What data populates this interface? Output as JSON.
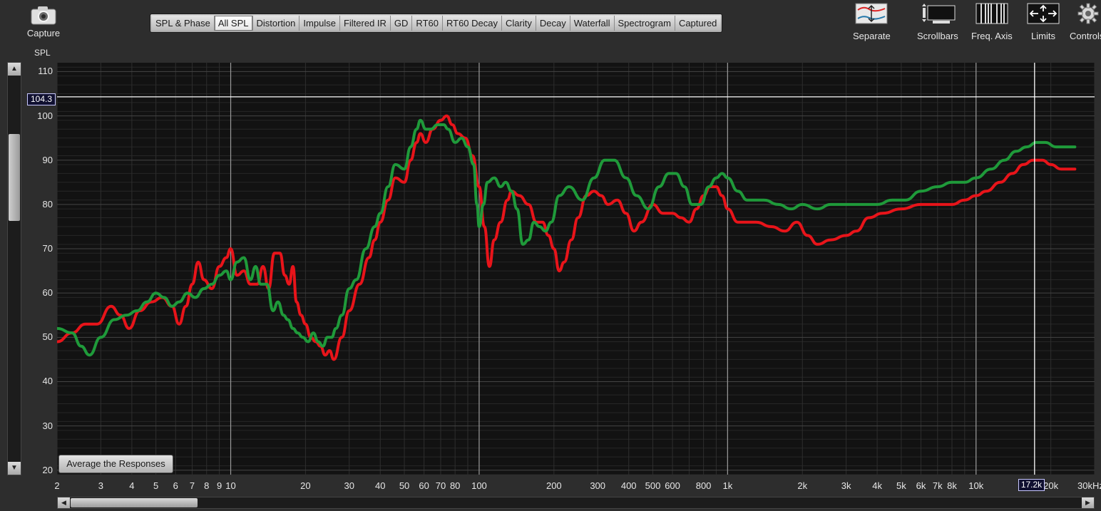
{
  "capture": {
    "label": "Capture"
  },
  "y_axis_title": "SPL",
  "tabs": [
    {
      "label": "SPL & Phase",
      "active": false
    },
    {
      "label": "All SPL",
      "active": true
    },
    {
      "label": "Distortion",
      "active": false
    },
    {
      "label": "Impulse",
      "active": false
    },
    {
      "label": "Filtered IR",
      "active": false
    },
    {
      "label": "GD",
      "active": false
    },
    {
      "label": "RT60",
      "active": false
    },
    {
      "label": "RT60 Decay",
      "active": false
    },
    {
      "label": "Clarity",
      "active": false
    },
    {
      "label": "Decay",
      "active": false
    },
    {
      "label": "Waterfall",
      "active": false
    },
    {
      "label": "Spectrogram",
      "active": false
    },
    {
      "label": "Captured",
      "active": false
    }
  ],
  "toolbar": {
    "separate": "Separate",
    "scrollbars": "Scrollbars",
    "freq_axis": "Freq. Axis",
    "limits": "Limits",
    "controls": "Controls"
  },
  "cursor": {
    "y_readout": "104.3",
    "x_readout": "17.2k"
  },
  "average_button": "Average the Responses",
  "colors": {
    "red_trace": "#e8141a",
    "green_trace": "#1f9a3a",
    "background": "#121212",
    "grid": "#3a3a3a",
    "cursor": "#ffffff"
  },
  "chart_data": {
    "type": "line",
    "x_scale": "log",
    "xlim": [
      2,
      30000
    ],
    "ylim": [
      19,
      112
    ],
    "y_ticks": [
      "110",
      "100",
      "90",
      "80",
      "70",
      "60",
      "50",
      "40",
      "30",
      "20"
    ],
    "x_ticks": [
      {
        "v": 2,
        "t": "2"
      },
      {
        "v": 3,
        "t": "3"
      },
      {
        "v": 4,
        "t": "4"
      },
      {
        "v": 5,
        "t": "5"
      },
      {
        "v": 6,
        "t": "6"
      },
      {
        "v": 7,
        "t": "7"
      },
      {
        "v": 8,
        "t": "8"
      },
      {
        "v": 9,
        "t": "9"
      },
      {
        "v": 10,
        "t": "10"
      },
      {
        "v": 20,
        "t": "20"
      },
      {
        "v": 30,
        "t": "30"
      },
      {
        "v": 40,
        "t": "40"
      },
      {
        "v": 50,
        "t": "50"
      },
      {
        "v": 60,
        "t": "60"
      },
      {
        "v": 70,
        "t": "70"
      },
      {
        "v": 80,
        "t": "80"
      },
      {
        "v": 100,
        "t": "100"
      },
      {
        "v": 200,
        "t": "200"
      },
      {
        "v": 300,
        "t": "300"
      },
      {
        "v": 400,
        "t": "400"
      },
      {
        "v": 500,
        "t": "500"
      },
      {
        "v": 600,
        "t": "600"
      },
      {
        "v": 800,
        "t": "800"
      },
      {
        "v": 1000,
        "t": "1k"
      },
      {
        "v": 2000,
        "t": "2k"
      },
      {
        "v": 3000,
        "t": "3k"
      },
      {
        "v": 4000,
        "t": "4k"
      },
      {
        "v": 5000,
        "t": "5k"
      },
      {
        "v": 6000,
        "t": "6k"
      },
      {
        "v": 7000,
        "t": "7k"
      },
      {
        "v": 8000,
        "t": "8k"
      },
      {
        "v": 10000,
        "t": "10k"
      },
      {
        "v": 20000,
        "t": "20k"
      },
      {
        "v": 30000,
        "t": "30kHz"
      }
    ],
    "cursor_y": 104.3,
    "cursor_x": 17200,
    "series": [
      {
        "color": "red",
        "points": [
          [
            2,
            49
          ],
          [
            2.3,
            51
          ],
          [
            2.6,
            53
          ],
          [
            2.9,
            53
          ],
          [
            3.3,
            57
          ],
          [
            3.6,
            55
          ],
          [
            3.9,
            52
          ],
          [
            4.3,
            56
          ],
          [
            4.8,
            58
          ],
          [
            5.3,
            59
          ],
          [
            5.8,
            57
          ],
          [
            6.2,
            53
          ],
          [
            6.6,
            57
          ],
          [
            7.0,
            62
          ],
          [
            7.4,
            67
          ],
          [
            7.8,
            63
          ],
          [
            8.4,
            61
          ],
          [
            9.0,
            66
          ],
          [
            9.6,
            68
          ],
          [
            10.0,
            70
          ],
          [
            10.6,
            64
          ],
          [
            11.3,
            65
          ],
          [
            12.0,
            62
          ],
          [
            12.8,
            62
          ],
          [
            13.5,
            66
          ],
          [
            14.2,
            61
          ],
          [
            15.0,
            69
          ],
          [
            15.8,
            69
          ],
          [
            16.5,
            64
          ],
          [
            17.2,
            62
          ],
          [
            17.8,
            66
          ],
          [
            18.4,
            58
          ],
          [
            19.2,
            55
          ],
          [
            20.0,
            53
          ],
          [
            21.0,
            50
          ],
          [
            22.0,
            49
          ],
          [
            23.0,
            48
          ],
          [
            24.0,
            46
          ],
          [
            25.0,
            47
          ],
          [
            26.0,
            45
          ],
          [
            28.0,
            50
          ],
          [
            30.0,
            56
          ],
          [
            33.0,
            62
          ],
          [
            36.0,
            68
          ],
          [
            38.0,
            72
          ],
          [
            40.0,
            76
          ],
          [
            43.0,
            81
          ],
          [
            46.0,
            86
          ],
          [
            50.0,
            85
          ],
          [
            53.0,
            90
          ],
          [
            56.0,
            94
          ],
          [
            58.0,
            96
          ],
          [
            61.0,
            94
          ],
          [
            65.0,
            97
          ],
          [
            70.0,
            99
          ],
          [
            74.0,
            100
          ],
          [
            78.0,
            98
          ],
          [
            82.0,
            96
          ],
          [
            88.0,
            95
          ],
          [
            94.0,
            91
          ],
          [
            100.0,
            84
          ],
          [
            105.0,
            75
          ],
          [
            110.0,
            66
          ],
          [
            115.0,
            72
          ],
          [
            122.0,
            76
          ],
          [
            130.0,
            81
          ],
          [
            135.0,
            83
          ],
          [
            145.0,
            82
          ],
          [
            158.0,
            80
          ],
          [
            170.0,
            76
          ],
          [
            180.0,
            76
          ],
          [
            190.0,
            73
          ],
          [
            200.0,
            70
          ],
          [
            210.0,
            65
          ],
          [
            220.0,
            67
          ],
          [
            235.0,
            72
          ],
          [
            250.0,
            77
          ],
          [
            270.0,
            82
          ],
          [
            290.0,
            83
          ],
          [
            310.0,
            82
          ],
          [
            330.0,
            80
          ],
          [
            360.0,
            81
          ],
          [
            390.0,
            78
          ],
          [
            420.0,
            74
          ],
          [
            450.0,
            76
          ],
          [
            500.0,
            80
          ],
          [
            550.0,
            78
          ],
          [
            600.0,
            78
          ],
          [
            650.0,
            77
          ],
          [
            700.0,
            76
          ],
          [
            750.0,
            79
          ],
          [
            800.0,
            82
          ],
          [
            850.0,
            84
          ],
          [
            900.0,
            84
          ],
          [
            950.0,
            82
          ],
          [
            1000.0,
            79
          ],
          [
            1100.0,
            76
          ],
          [
            1300.0,
            76
          ],
          [
            1500.0,
            75
          ],
          [
            1700.0,
            74
          ],
          [
            1900.0,
            76
          ],
          [
            2100.0,
            73
          ],
          [
            2300.0,
            71
          ],
          [
            2600.0,
            72
          ],
          [
            3000.0,
            73
          ],
          [
            3300.0,
            74
          ],
          [
            3700.0,
            77
          ],
          [
            4200.0,
            78
          ],
          [
            5000.0,
            79
          ],
          [
            6000.0,
            80
          ],
          [
            7000.0,
            80
          ],
          [
            8000.0,
            80
          ],
          [
            9000.0,
            81
          ],
          [
            10000.0,
            82
          ],
          [
            11000.0,
            83
          ],
          [
            12500.0,
            85
          ],
          [
            14000.0,
            87
          ],
          [
            15500.0,
            89
          ],
          [
            17000.0,
            90
          ],
          [
            18500.0,
            90
          ],
          [
            20000.0,
            89
          ],
          [
            22000.0,
            88
          ],
          [
            25000.0,
            88
          ]
        ]
      },
      {
        "color": "green",
        "points": [
          [
            2,
            52
          ],
          [
            2.3,
            51
          ],
          [
            2.5,
            48
          ],
          [
            2.7,
            46
          ],
          [
            3.0,
            50
          ],
          [
            3.4,
            54
          ],
          [
            3.8,
            55
          ],
          [
            4.2,
            56
          ],
          [
            4.6,
            58
          ],
          [
            5.0,
            60
          ],
          [
            5.4,
            59
          ],
          [
            5.8,
            57
          ],
          [
            6.2,
            58
          ],
          [
            6.7,
            60
          ],
          [
            7.2,
            59
          ],
          [
            7.8,
            61
          ],
          [
            8.4,
            62
          ],
          [
            9.0,
            64
          ],
          [
            9.6,
            65
          ],
          [
            10.0,
            63
          ],
          [
            10.6,
            67
          ],
          [
            11.3,
            68
          ],
          [
            12.0,
            63
          ],
          [
            12.6,
            66
          ],
          [
            13.2,
            62
          ],
          [
            14.0,
            62
          ],
          [
            14.8,
            56
          ],
          [
            15.5,
            58
          ],
          [
            16.3,
            55
          ],
          [
            17.0,
            54
          ],
          [
            17.8,
            52
          ],
          [
            18.6,
            51
          ],
          [
            19.5,
            50
          ],
          [
            20.5,
            49
          ],
          [
            21.5,
            51
          ],
          [
            22.5,
            49
          ],
          [
            23.5,
            48
          ],
          [
            24.5,
            50
          ],
          [
            25.5,
            50
          ],
          [
            26.5,
            52
          ],
          [
            28.0,
            55
          ],
          [
            30.0,
            61
          ],
          [
            32.0,
            63
          ],
          [
            35.0,
            70
          ],
          [
            38.0,
            75
          ],
          [
            40.0,
            78
          ],
          [
            43.0,
            84
          ],
          [
            46.0,
            89
          ],
          [
            50.0,
            88
          ],
          [
            53.0,
            93
          ],
          [
            56.0,
            97
          ],
          [
            58.0,
            99
          ],
          [
            61.0,
            97
          ],
          [
            64.0,
            97
          ],
          [
            68.0,
            98
          ],
          [
            72.0,
            98
          ],
          [
            75.0,
            97
          ],
          [
            80.0,
            94
          ],
          [
            85.0,
            95
          ],
          [
            90.0,
            93
          ],
          [
            95.0,
            89
          ],
          [
            98.0,
            80
          ],
          [
            100.0,
            75
          ],
          [
            104.0,
            80
          ],
          [
            108.0,
            85
          ],
          [
            115.0,
            86
          ],
          [
            122.0,
            84
          ],
          [
            128.0,
            85
          ],
          [
            135.0,
            83
          ],
          [
            142.0,
            79
          ],
          [
            150.0,
            71
          ],
          [
            158.0,
            72
          ],
          [
            166.0,
            76
          ],
          [
            175.0,
            75
          ],
          [
            185.0,
            74
          ],
          [
            195.0,
            76
          ],
          [
            210.0,
            82
          ],
          [
            230.0,
            84
          ],
          [
            260.0,
            81
          ],
          [
            290.0,
            86
          ],
          [
            320.0,
            90
          ],
          [
            350.0,
            90
          ],
          [
            390.0,
            86
          ],
          [
            430.0,
            82
          ],
          [
            480.0,
            79
          ],
          [
            530.0,
            84
          ],
          [
            580.0,
            87
          ],
          [
            620.0,
            87
          ],
          [
            670.0,
            84
          ],
          [
            720.0,
            80
          ],
          [
            780.0,
            80
          ],
          [
            840.0,
            84
          ],
          [
            900.0,
            86
          ],
          [
            950.0,
            87
          ],
          [
            1000.0,
            86
          ],
          [
            1100.0,
            83
          ],
          [
            1200.0,
            81
          ],
          [
            1400.0,
            81
          ],
          [
            1600.0,
            80
          ],
          [
            1800.0,
            79
          ],
          [
            2000.0,
            80
          ],
          [
            2300.0,
            79
          ],
          [
            2600.0,
            80
          ],
          [
            3000.0,
            80
          ],
          [
            3500.0,
            80
          ],
          [
            4000.0,
            80
          ],
          [
            4600.0,
            81
          ],
          [
            5200.0,
            81
          ],
          [
            6000.0,
            83
          ],
          [
            7000.0,
            84
          ],
          [
            8000.0,
            85
          ],
          [
            9000.0,
            85
          ],
          [
            10000.0,
            86
          ],
          [
            11500.0,
            88
          ],
          [
            13000.0,
            90
          ],
          [
            14500.0,
            92
          ],
          [
            16000.0,
            93
          ],
          [
            17500.0,
            94
          ],
          [
            19000.0,
            94
          ],
          [
            21000.0,
            93
          ],
          [
            23000.0,
            93
          ],
          [
            25000.0,
            93
          ]
        ]
      }
    ]
  }
}
